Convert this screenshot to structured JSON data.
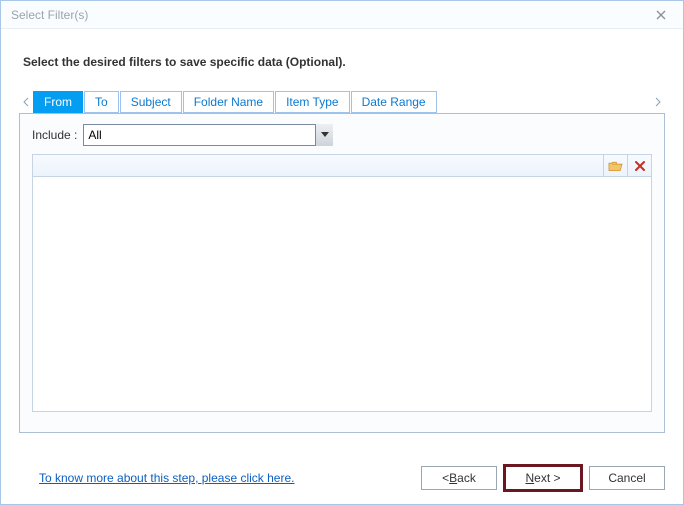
{
  "window": {
    "title": "Select Filter(s)",
    "close_icon": "×"
  },
  "instruction": "Select the desired filters to save specific data (Optional).",
  "tabs": {
    "items": [
      {
        "label": "From",
        "active": true
      },
      {
        "label": "To",
        "active": false
      },
      {
        "label": "Subject",
        "active": false
      },
      {
        "label": "Folder Name",
        "active": false
      },
      {
        "label": "Item Type",
        "active": false
      },
      {
        "label": "Date Range",
        "active": false
      }
    ]
  },
  "include": {
    "label": "Include :",
    "selected": "All",
    "options": [
      "All"
    ]
  },
  "list_toolbar": {
    "folder_icon": "folder-open-icon",
    "remove_icon": "×"
  },
  "help_link": "To know more about this step, please click here.",
  "buttons": {
    "back": {
      "prefix": "< ",
      "mnemonic": "B",
      "rest": "ack"
    },
    "next": {
      "mnemonic": "N",
      "rest": "ext >"
    },
    "cancel": {
      "label": "Cancel"
    }
  }
}
